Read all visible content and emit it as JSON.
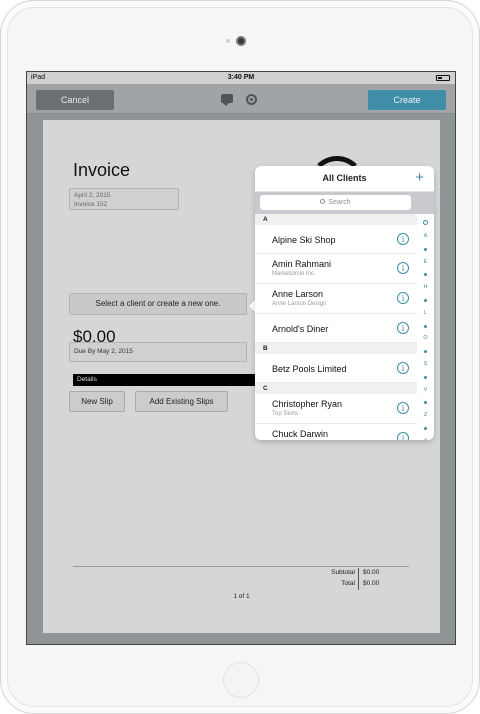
{
  "status_bar": {
    "carrier": "iPad",
    "time": "3:40 PM"
  },
  "nav": {
    "cancel_label": "Cancel",
    "create_label": "Create"
  },
  "invoice": {
    "title": "Invoice",
    "date": "April 2, 2015",
    "number": "Invoice 152",
    "client_prompt": "Select a client or create a new one.",
    "amount": "$0.00",
    "due": "Due By May 2, 2015",
    "details_label": "Details",
    "new_slip_label": "New Slip",
    "add_existing_label": "Add Existing Slips",
    "subtotal_label": "Subtotal",
    "subtotal_value": "$0.00",
    "total_label": "Total",
    "total_value": "$0.00",
    "page_count": "1 of 1"
  },
  "popover": {
    "title": "All Clients",
    "search_placeholder": "Search",
    "sections": [
      {
        "letter": "A",
        "clients": [
          {
            "name": "Alpine Ski Shop",
            "company": ""
          },
          {
            "name": "Amin Rahmani",
            "company": "Marketcircle Inc."
          },
          {
            "name": "Anne Larson",
            "company": "Anne Larson Design"
          },
          {
            "name": "Arnold's Diner",
            "company": ""
          }
        ]
      },
      {
        "letter": "B",
        "clients": [
          {
            "name": "Betz Pools Limited",
            "company": ""
          }
        ]
      },
      {
        "letter": "C",
        "clients": [
          {
            "name": "Christopher Ryan",
            "company": "Top Skins"
          },
          {
            "name": "Chuck Darwin",
            "company": ""
          }
        ]
      }
    ],
    "index_letters": [
      "A",
      "E",
      "H",
      "L",
      "O",
      "S",
      "V",
      "Z",
      "#"
    ]
  },
  "colors": {
    "accent": "#3f8da6",
    "cancel_button": "#6c6f71",
    "overlay": "#8f9496"
  }
}
